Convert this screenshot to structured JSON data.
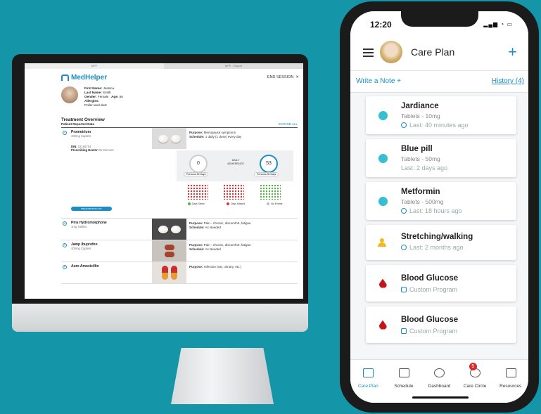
{
  "desktop": {
    "tabs": [
      "MFP",
      "MFP - Report"
    ],
    "brand": "MedHelper",
    "end_session": "END SESSION",
    "patient": {
      "first_name_label": "First Name:",
      "first_name": "Jessica",
      "last_name_label": "Last Name:",
      "last_name": "Smith",
      "gender_label": "Gender:",
      "gender": "Female",
      "age_label": "Age:",
      "age": "56",
      "allergies_label": "Allergies:",
      "allergies": "Pollen and dust"
    },
    "section_title": "Treatment Overview",
    "section_sub": "Patient Reported Data",
    "expand_all": "EXPAND ALL",
    "meds": [
      {
        "name": "Prometrium",
        "dose": "100mg Caplets",
        "purpose": "Menopause symptoms",
        "schedule": "1 daily (1 dose) every day",
        "din_label": "DIN:",
        "din": "02166704",
        "doctor_label": "Prescribing Doctor:",
        "doctor": "Dr Dumont"
      },
      {
        "name": "Pms Hydromorphone",
        "dose": "1mg Tablets",
        "purpose": "Pain - chronic, discomfort, fatigue",
        "schedule": "As Needed"
      },
      {
        "name": "Jamp Ibuprofen",
        "dose": "400mg Caplets",
        "purpose": "Pain - chronic, discomfort, fatigue",
        "schedule": "As Needed"
      },
      {
        "name": "Auro Amoxicillin",
        "dose": "",
        "purpose": "Infection (ear, urinary, etc.)",
        "schedule": ""
      }
    ],
    "purpose_label": "Purpose:",
    "schedule_label": "Schedule:",
    "adherence": {
      "label_line1": "DAILY",
      "label_line2": "ADHERENCE",
      "value_30": "0",
      "value_90": "53",
      "prev_30": "Previous 30 Days",
      "prev_90": "Previous 90 Days"
    },
    "legend": {
      "taken": "Days Taken",
      "missed": "Days Missed",
      "no_events": "No Events"
    },
    "legend_colors": {
      "taken": "#58b148",
      "missed": "#d9373a",
      "no_events": "#bbbbbb"
    },
    "small_button": "PRESCRIPTION LIST"
  },
  "mobile": {
    "time": "12:20",
    "title": "Care Plan",
    "write_note": "Write a Note +",
    "history": "History (4)",
    "items": [
      {
        "title": "Jardiance",
        "subtitle": "Tablets - 10mg",
        "meta": "Last: 40 minutes ago",
        "icon": "check-circle-icon"
      },
      {
        "title": "Blue pill",
        "subtitle": "Tablets - 50mg",
        "meta": "Last: 2 days ago",
        "icon": "check-circle-icon"
      },
      {
        "title": "Metformin",
        "subtitle": "Tablets - 500mg",
        "meta": "Last: 18 hours ago",
        "icon": "check-circle-icon"
      },
      {
        "title": "Stretching/walking",
        "subtitle": "",
        "meta": "Last: 2 months ago",
        "icon": "person-add-icon"
      },
      {
        "title": "Blood Glucose",
        "subtitle": "",
        "meta": "Custom Program",
        "icon": "blood-drop-icon"
      },
      {
        "title": "Blood Glucose",
        "subtitle": "",
        "meta": "Custom Program",
        "icon": "blood-drop-icon"
      }
    ],
    "nav": [
      {
        "label": "Care Plan",
        "icon": "medkit-icon"
      },
      {
        "label": "Schedule",
        "icon": "calendar-icon"
      },
      {
        "label": "Dashboard",
        "icon": "heart-icon"
      },
      {
        "label": "Care Circle",
        "icon": "people-icon",
        "badge": "5"
      },
      {
        "label": "Resources",
        "icon": "store-icon"
      }
    ],
    "accent": "#1b8dc2"
  }
}
